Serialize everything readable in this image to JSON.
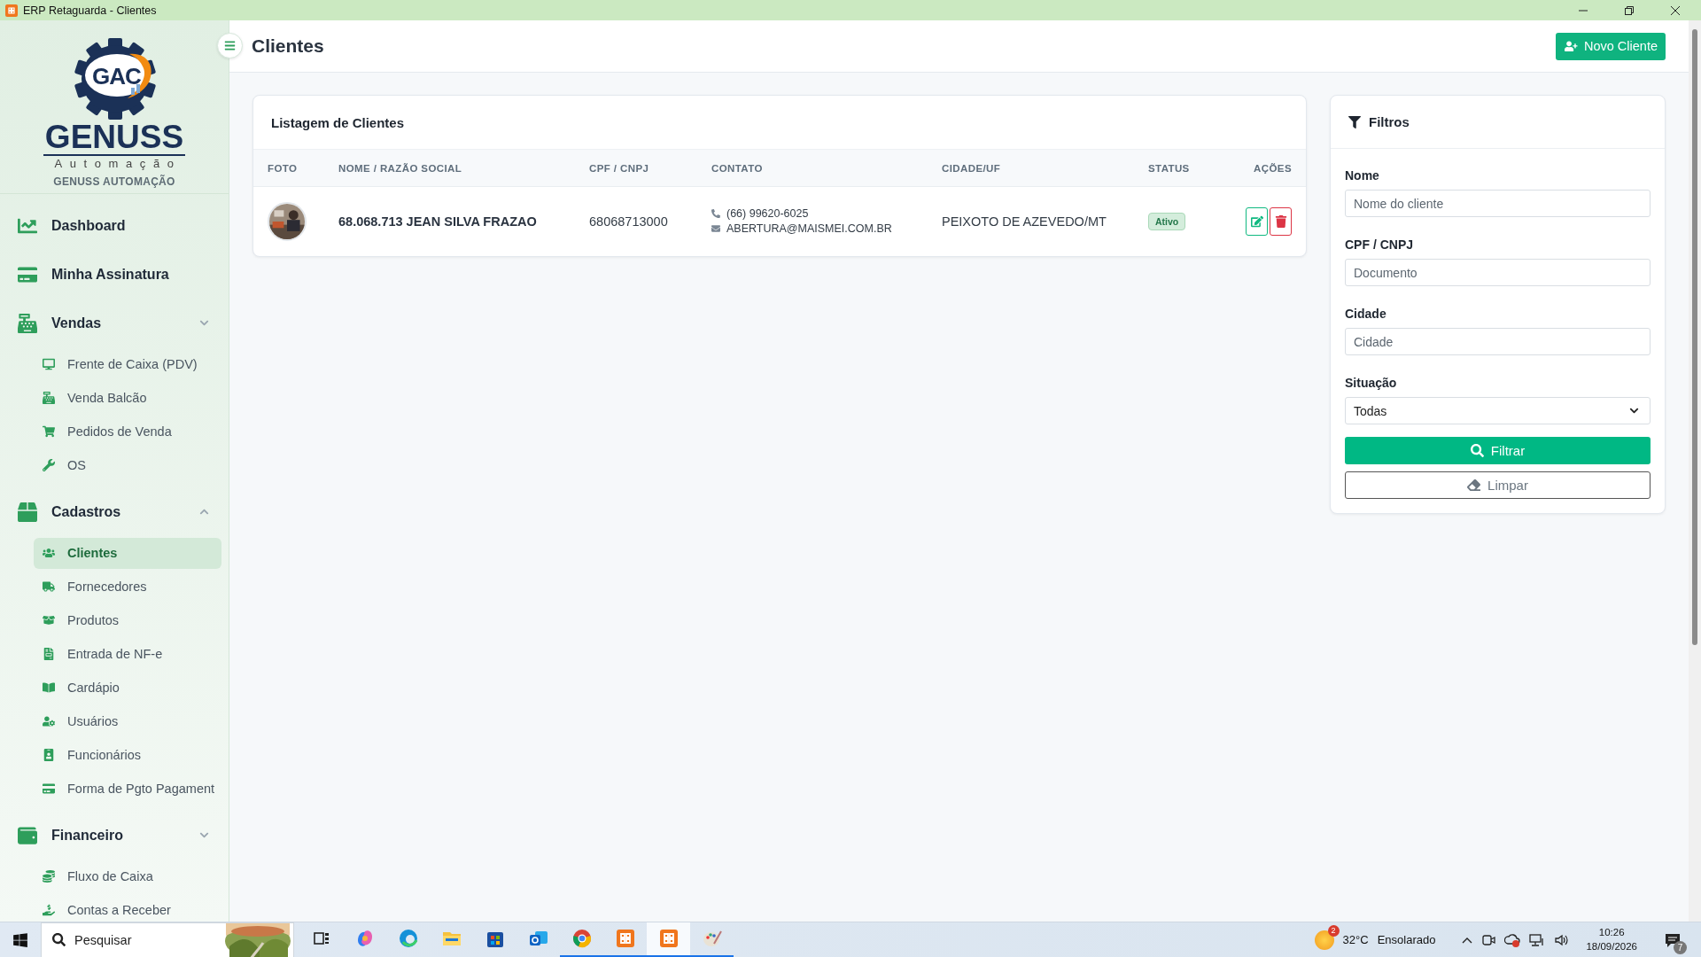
{
  "window": {
    "title": "ERP Retaguarda - Clientes"
  },
  "sidebar": {
    "logo": {
      "mark": "GAC",
      "wordmark": "GENUSS",
      "tagline": "Automação"
    },
    "brand": "GENUSS AUTOMAÇÃO",
    "menu": [
      {
        "kind": "link",
        "label": "Dashboard"
      },
      {
        "kind": "link",
        "label": "Minha Assinatura"
      },
      {
        "kind": "group",
        "label": "Vendas",
        "expanded": false,
        "children": [
          {
            "label": "Frente de Caixa (PDV)",
            "selected": false
          },
          {
            "label": "Venda Balcão",
            "selected": false
          },
          {
            "label": "Pedidos de Venda",
            "selected": false
          },
          {
            "label": "OS",
            "selected": false
          }
        ]
      },
      {
        "kind": "group",
        "label": "Cadastros",
        "expanded": true,
        "children": [
          {
            "label": "Clientes",
            "selected": true
          },
          {
            "label": "Fornecedores",
            "selected": false
          },
          {
            "label": "Produtos",
            "selected": false
          },
          {
            "label": "Entrada de NF-e",
            "selected": false
          },
          {
            "label": "Cardápio",
            "selected": false
          },
          {
            "label": "Usuários",
            "selected": false
          },
          {
            "label": "Funcionários",
            "selected": false
          },
          {
            "label": "Forma de Pgto Pagament",
            "selected": false
          }
        ]
      },
      {
        "kind": "group",
        "label": "Financeiro",
        "expanded": false,
        "children": [
          {
            "label": "Fluxo de Caixa",
            "selected": false
          },
          {
            "label": "Contas a Receber",
            "selected": false
          }
        ]
      }
    ]
  },
  "header": {
    "title": "Clientes",
    "new_button": "Novo Cliente"
  },
  "table": {
    "title": "Listagem de Clientes",
    "columns": [
      "FOTO",
      "NOME / RAZÃO SOCIAL",
      "CPF / CNPJ",
      "CONTATO",
      "CIDADE/UF",
      "STATUS",
      "AÇÕES"
    ],
    "rows": [
      {
        "name": "68.068.713 JEAN SILVA FRAZAO",
        "document": "68068713000",
        "phone": "(66) 99620-6025",
        "email": "ABERTURA@MAISMEI.COM.BR",
        "city": "PEIXOTO DE AZEVEDO/MT",
        "status": {
          "label": "Ativo",
          "active": true
        }
      }
    ]
  },
  "filters": {
    "title": "Filtros",
    "fields": [
      {
        "kind": "text",
        "label": "Nome",
        "placeholder": "Nome do cliente"
      },
      {
        "kind": "text",
        "label": "CPF / CNPJ",
        "placeholder": "Documento"
      },
      {
        "kind": "text",
        "label": "Cidade",
        "placeholder": "Cidade"
      },
      {
        "kind": "select",
        "label": "Situação",
        "value": "Todas"
      }
    ],
    "apply_button": "Filtrar",
    "clear_button": "Limpar"
  },
  "taskbar": {
    "search_placeholder": "Pesquisar",
    "apps": [
      {
        "running": false,
        "selected": false
      },
      {
        "running": false,
        "selected": false
      },
      {
        "running": false,
        "selected": false
      },
      {
        "running": false,
        "selected": false
      },
      {
        "running": false,
        "selected": false
      },
      {
        "running": false,
        "selected": false
      },
      {
        "running": true,
        "selected": false
      },
      {
        "running": true,
        "selected": false
      },
      {
        "running": true,
        "selected": true
      },
      {
        "running": true,
        "selected": false
      }
    ],
    "weather": {
      "badge": "2",
      "temperature": "32°C",
      "condition": "Ensolarado"
    },
    "clock": {
      "time": "10:26",
      "date": "18/09/2026"
    },
    "notifications": "7"
  }
}
